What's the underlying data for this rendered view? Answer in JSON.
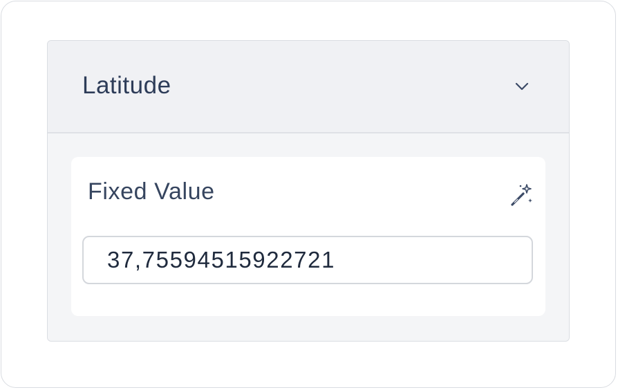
{
  "section": {
    "title": "Latitude",
    "collapse_icon": "chevron-down-icon"
  },
  "field": {
    "label": "Fixed Value",
    "action_icon": "magic-wand-icon",
    "value": "37,75594515922721"
  },
  "colors": {
    "header_bg": "#f0f1f4",
    "text": "#2d3c58",
    "border": "#d4d7dc"
  }
}
